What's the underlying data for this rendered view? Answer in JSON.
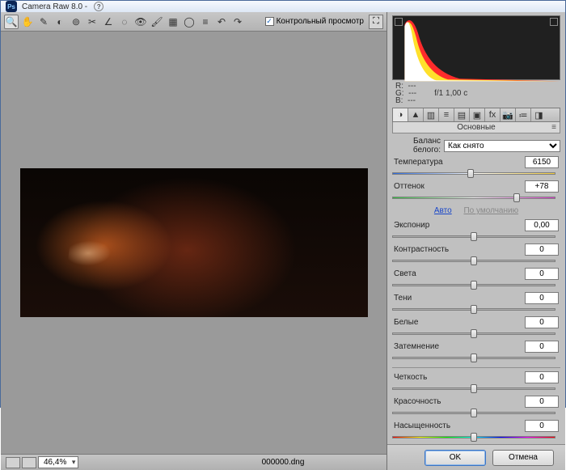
{
  "title": "Camera Raw 8.0  -",
  "toolbar": {
    "preview_label": "Контрольный просмотр",
    "preview_checked": true
  },
  "status": {
    "zoom": "46,4%",
    "filename": "000000.dng"
  },
  "meta": {
    "rgb": "R:  ---\nG:  ---\nB:  ---",
    "exposure": "f/1   1,00 c"
  },
  "panel": {
    "title": "Основные",
    "wb_label": "Баланс белого:",
    "wb_value": "Как снято",
    "links": {
      "auto": "Авто",
      "default": "По умолчанию"
    }
  },
  "sliders": {
    "temperature": {
      "label": "Температура",
      "value": "6150",
      "pos": 48
    },
    "tint": {
      "label": "Оттенок",
      "value": "+78",
      "pos": 76
    },
    "exposure": {
      "label": "Экспонир",
      "value": "0,00",
      "pos": 50
    },
    "contrast": {
      "label": "Контрастность",
      "value": "0",
      "pos": 50
    },
    "highlights": {
      "label": "Света",
      "value": "0",
      "pos": 50
    },
    "shadows": {
      "label": "Тени",
      "value": "0",
      "pos": 50
    },
    "whites": {
      "label": "Белые",
      "value": "0",
      "pos": 50
    },
    "blacks": {
      "label": "Затемнение",
      "value": "0",
      "pos": 50
    },
    "clarity": {
      "label": "Четкость",
      "value": "0",
      "pos": 50
    },
    "vibrance": {
      "label": "Красочность",
      "value": "0",
      "pos": 50
    },
    "saturation": {
      "label": "Насыщенность",
      "value": "0",
      "pos": 50
    }
  },
  "buttons": {
    "ok": "OK",
    "cancel": "Отмена"
  }
}
